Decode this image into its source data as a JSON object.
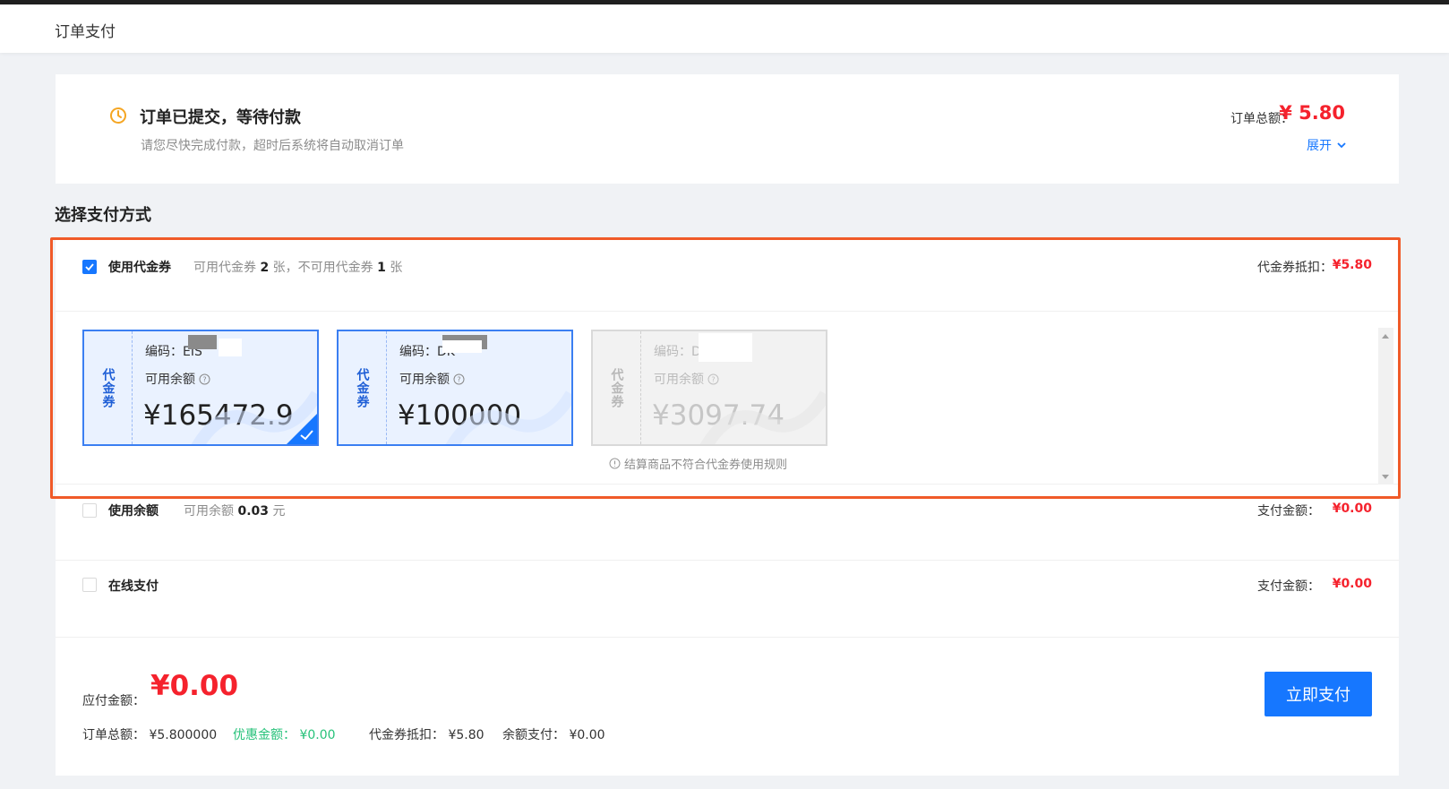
{
  "header": {
    "title": "订单支付"
  },
  "status": {
    "title": "订单已提交，等待付款",
    "desc": "请您尽快完成付款，超时后系统将自动取消订单",
    "total_label": "订单总额：",
    "total_value": "¥ 5.80",
    "expand_label": "展开"
  },
  "section": {
    "title": "选择支付方式"
  },
  "voucher": {
    "checked": true,
    "label": "使用代金券",
    "avail_prefix": "可用代金券",
    "avail_count": "2",
    "avail_mid": "张，不可用代金券",
    "unavail_count": "1",
    "unavail_suffix": "张",
    "deduct_label": "代金券抵扣：",
    "deduct_value": "¥5.80",
    "cards": [
      {
        "tag": "代金券",
        "code": "编码：EIS",
        "avail_label": "可用余额",
        "amount": "¥165472.9",
        "selected": true,
        "disabled": false
      },
      {
        "tag": "代金券",
        "code": "编码：DK",
        "avail_label": "可用余额",
        "amount": "¥100000",
        "selected": false,
        "disabled": false
      },
      {
        "tag": "代金券",
        "code": "编码：DC",
        "avail_label": "可用余额",
        "amount": "¥3097.74",
        "selected": false,
        "disabled": true
      }
    ],
    "disabled_note": "结算商品不符合代金券使用规则"
  },
  "balance": {
    "checked": false,
    "label": "使用余额",
    "avail_prefix": "可用余额",
    "avail_value": "0.03",
    "avail_suffix": "元",
    "pay_label": "支付金额：",
    "pay_value": "¥0.00"
  },
  "online": {
    "checked": false,
    "label": "在线支付",
    "pay_label": "支付金额：",
    "pay_value": "¥0.00"
  },
  "summary": {
    "due_label": "应付金额：",
    "due_value": "¥0.00",
    "order_total": "订单总额：  ¥5.800000",
    "discount": "优惠金额：  ¥0.00",
    "voucher_deduct": "代金券抵扣：  ¥5.80",
    "balance_pay": "余额支付：  ¥0.00",
    "pay_button": "立即支付"
  },
  "colors": {
    "accent": "#1677ff",
    "price": "#f5222d",
    "highlight_border": "#f05a28",
    "discount": "#27c27a"
  }
}
